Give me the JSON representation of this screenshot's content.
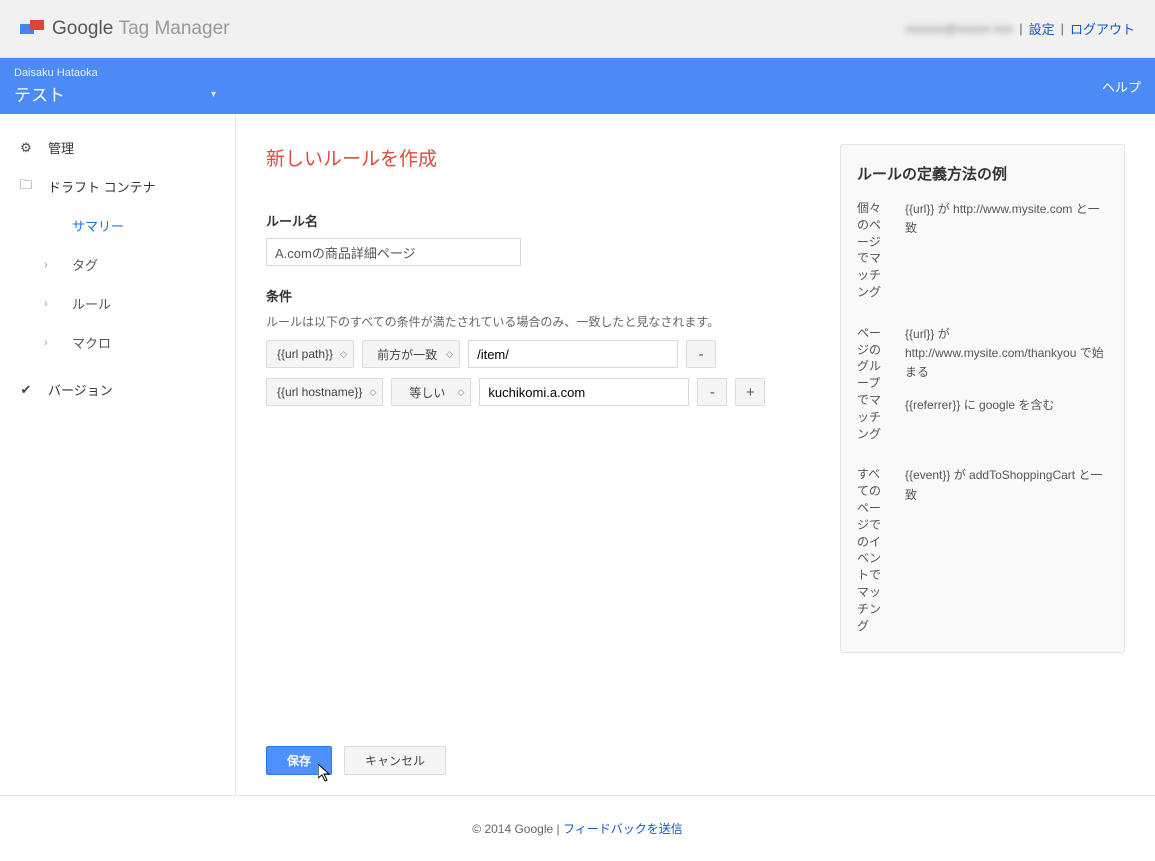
{
  "topbar": {
    "brand_google": "Google",
    "brand_product": "Tag Manager",
    "user_email_blurred": "xxxxxx@xxxxx.xxx",
    "settings": "設定",
    "logout": "ログアウト"
  },
  "bluebar": {
    "account_name": "Daisaku Hataoka",
    "container_name": "テスト",
    "help": "ヘルプ"
  },
  "sidebar": {
    "admin": "管理",
    "draft_container": "ドラフト コンテナ",
    "summary": "サマリー",
    "tags": "タグ",
    "rules": "ルール",
    "macros": "マクロ",
    "versions": "バージョン"
  },
  "form": {
    "page_title": "新しいルールを作成",
    "rule_name_label": "ルール名",
    "rule_name_value": "A.comの商品詳細ページ",
    "conditions_label": "条件",
    "conditions_hint": "ルールは以下のすべての条件が満たされている場合のみ、一致したと見なされます。",
    "rows": [
      {
        "variable": "{{url path}}",
        "operator": "前方が一致",
        "value": "/item/"
      },
      {
        "variable": "{{url hostname}}",
        "operator": "等しい",
        "value": "kuchikomi.a.com"
      }
    ],
    "minus": "-",
    "plus": "+",
    "save": "保存",
    "cancel": "キャンセル"
  },
  "help_panel": {
    "title": "ルールの定義方法の例",
    "examples": [
      {
        "scope": "個々のページでマッチング",
        "body": "{{url}} が http://www.mysite.com と一致"
      },
      {
        "scope": "ページのグループでマッチング",
        "body": "{{url}} が http://www.mysite.com/thankyou で始まる"
      },
      {
        "scope": "",
        "body": "{{referrer}} に google を含む"
      },
      {
        "scope": "すべてのページでのイベントでマッチング",
        "body": "{{event}} が addToShoppingCart と一致"
      }
    ]
  },
  "footer": {
    "copyright": "© 2014 Google",
    "feedback": "フィードバックを送信"
  }
}
